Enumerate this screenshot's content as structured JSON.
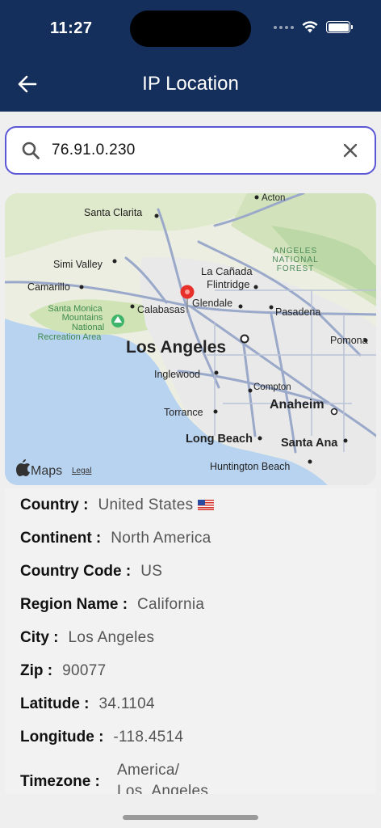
{
  "status_bar": {
    "time": "11:27"
  },
  "header": {
    "title": "IP Location"
  },
  "search": {
    "value": "76.91.0.230",
    "placeholder": ""
  },
  "map": {
    "labels": {
      "acton": "Acton",
      "santa_clarita": "Santa Clarita",
      "angeles_forest": "ANGELES NATIONAL FOREST",
      "simi_valley": "Simi Valley",
      "la_canada": "La Cañada Flintridge",
      "camarillo": "Camarillo",
      "santa_monica_mtns": "Santa Monica Mountains National Recreation Area",
      "calabasas": "Calabasas",
      "glendale": "Glendale",
      "pasadena": "Pasadena",
      "los_angeles": "Los Angeles",
      "pomona": "Pomona",
      "inglewood": "Inglewood",
      "compton": "Compton",
      "anaheim": "Anaheim",
      "torrance": "Torrance",
      "long_beach": "Long Beach",
      "santa_ana": "Santa Ana",
      "huntington_beach": "Huntington Beach"
    },
    "attribution": "Maps",
    "legal": "Legal"
  },
  "details": {
    "country_label": "Country :",
    "country_value": "United States",
    "continent_label": "Continent :",
    "continent_value": "North America",
    "country_code_label": "Country Code :",
    "country_code_value": "US",
    "region_label": "Region Name :",
    "region_value": "California",
    "city_label": "City :",
    "city_value": "Los Angeles",
    "zip_label": "Zip :",
    "zip_value": "90077",
    "latitude_label": "Latitude :",
    "latitude_value": "34.1104",
    "longitude_label": "Longitude :",
    "longitude_value": "-118.4514",
    "timezone_label": "Timezone :",
    "timezone_value": "America/ Los_Angeles"
  },
  "colors": {
    "header": "#142f5c",
    "accent": "#5b56d6",
    "pin": "#e8302a"
  }
}
